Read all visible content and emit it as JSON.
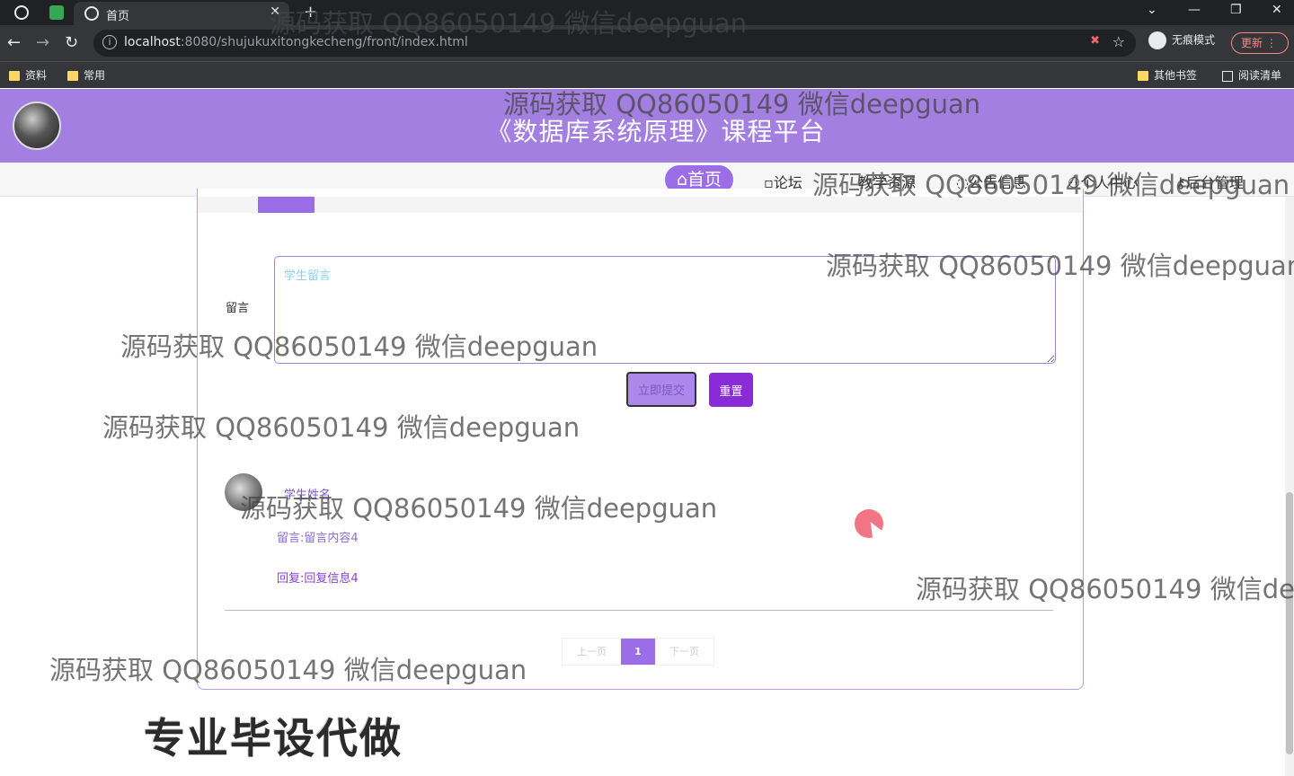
{
  "browser": {
    "tab_title": "首页",
    "url_host": "localhost",
    "url_rest": ":8080/shujukuxitongkecheng/front/index.html",
    "incognito_label": "无痕模式",
    "update_label": "更新",
    "bookmarks": [
      "资料",
      "常用"
    ],
    "bookmarks_right": [
      "其他书签",
      "阅读清单"
    ]
  },
  "site": {
    "title": "《数据库系统原理》课程平台",
    "nav": [
      {
        "label": "⌂首页"
      },
      {
        "label": "论坛"
      },
      {
        "label": "教学资源"
      },
      {
        "label": "公告信息"
      },
      {
        "label": "个人中心"
      },
      {
        "label": "后台管理"
      }
    ]
  },
  "form": {
    "label": "留言",
    "placeholder": "学生留言",
    "submit_label": "立即提交",
    "reset_label": "重置"
  },
  "comment": {
    "name": "学生姓名",
    "content": "留言:留言内容4",
    "reply": "回复:回复信息4"
  },
  "pager": {
    "prev": "上一页",
    "current": "1",
    "next": "下一页"
  },
  "watermark": "源码获取 QQ86050149 微信deepguan",
  "banner": "专业毕设代做",
  "colors": {
    "header": "#a27fe0",
    "accent": "#9b6ee8",
    "reset_button": "#8a2bd8"
  }
}
